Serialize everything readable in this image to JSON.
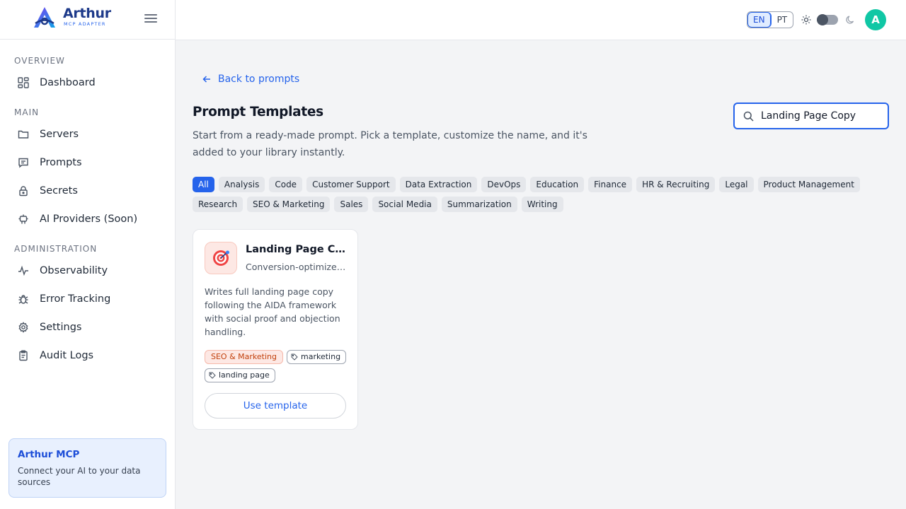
{
  "brand": {
    "name": "Arthur",
    "subtitle": "MCP ADAPTER"
  },
  "sidebar": {
    "sections": [
      {
        "title": "OVERVIEW"
      },
      {
        "title": "MAIN"
      },
      {
        "title": "ADMINISTRATION"
      }
    ],
    "items": [
      {
        "label": "Dashboard",
        "icon": "dashboard-icon"
      },
      {
        "label": "Servers",
        "icon": "folder-icon"
      },
      {
        "label": "Prompts",
        "icon": "message-icon"
      },
      {
        "label": "Secrets",
        "icon": "lock-icon"
      },
      {
        "label": "AI Providers (Soon)",
        "icon": "bot-icon"
      },
      {
        "label": "Observability",
        "icon": "activity-icon"
      },
      {
        "label": "Error Tracking",
        "icon": "bug-icon"
      },
      {
        "label": "Settings",
        "icon": "gear-icon"
      },
      {
        "label": "Audit Logs",
        "icon": "clipboard-icon"
      }
    ],
    "promo": {
      "title": "Arthur MCP",
      "text": "Connect your AI to your data sources"
    }
  },
  "header": {
    "languages": [
      "EN",
      "PT"
    ],
    "active_language": "EN",
    "avatar_initial": "A"
  },
  "main": {
    "back_label": "Back to prompts",
    "title": "Prompt Templates",
    "description": "Start from a ready-made prompt. Pick a template, customize the name, and it's added to your library instantly.",
    "search_value": "Landing Page Copy",
    "categories_row1": [
      "All",
      "Analysis",
      "Code",
      "Customer Support",
      "Data Extraction",
      "DevOps",
      "Education",
      "Finance",
      "HR & Recruiting",
      "Legal",
      "Product Management"
    ],
    "categories_row2": [
      "Research",
      "SEO & Marketing",
      "Sales",
      "Social Media",
      "Summarization",
      "Writing"
    ],
    "active_category": "All",
    "cards": [
      {
        "title": "Landing Page Copy",
        "subtitle": "Conversion-optimized landing page copy",
        "description": "Writes full landing page copy following the AIDA framework with social proof and objection handling.",
        "category": "SEO & Marketing",
        "tags": [
          "marketing",
          "landing page"
        ],
        "button": "Use template",
        "icon": "target-icon"
      }
    ]
  },
  "colors": {
    "accent": "#2563eb",
    "avatar": "#10c7a5",
    "category_tag": "#c2410c"
  }
}
